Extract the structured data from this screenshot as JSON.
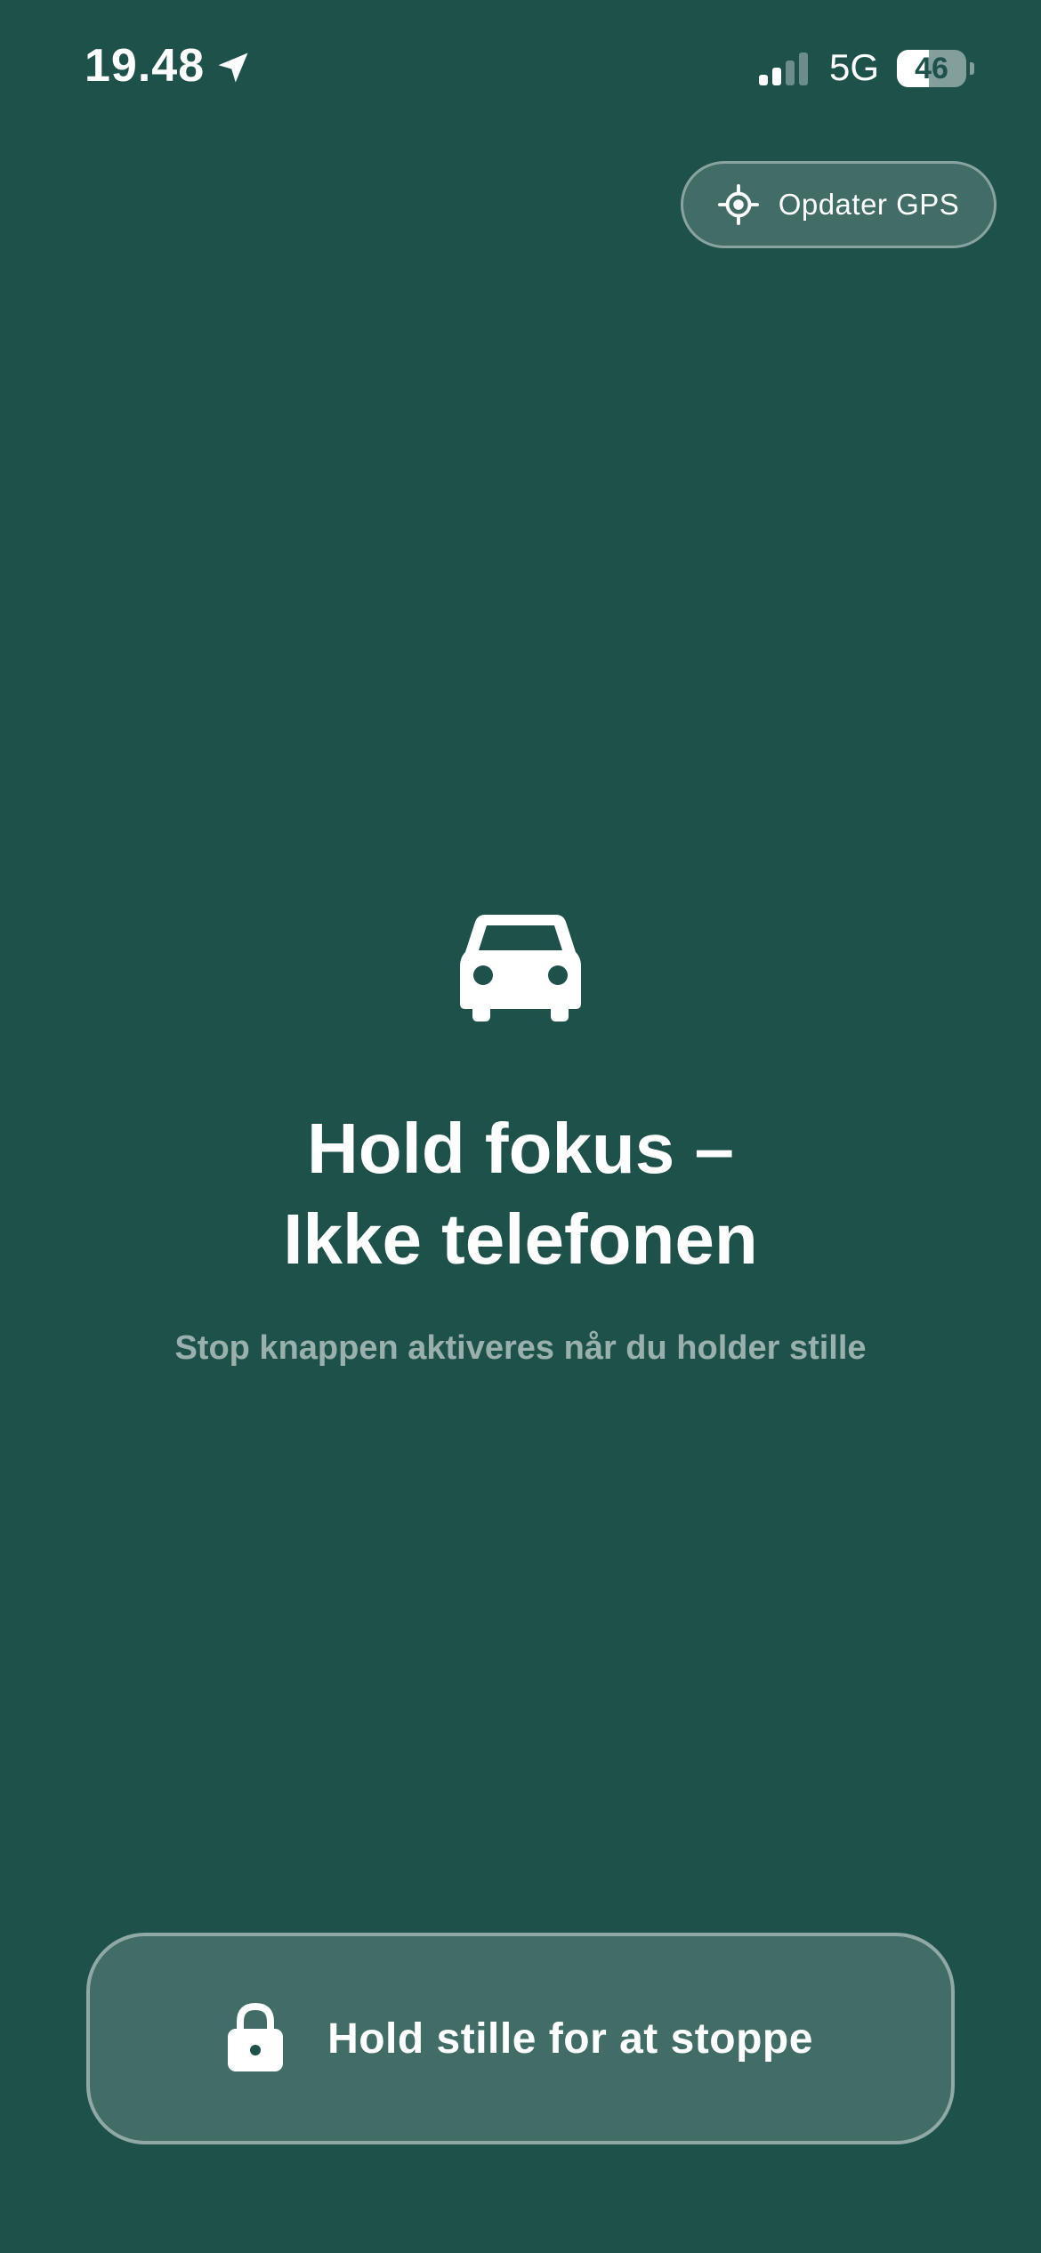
{
  "status_bar": {
    "time": "19.48",
    "network": "5G",
    "battery_percent": "46",
    "battery_level": 0.46,
    "signal_bars_active": 2,
    "signal_bars_total": 4,
    "location_icon": "location-arrow-icon"
  },
  "gps_button": {
    "label": "Opdater GPS",
    "icon": "crosshair-icon"
  },
  "main": {
    "icon": "car-icon",
    "title_line1": "Hold fokus –",
    "title_line2": "Ikke telefonen",
    "subtitle": "Stop knappen aktiveres når du holder stille"
  },
  "stop_button": {
    "label": "Hold stille for at stoppe",
    "icon": "lock-icon"
  },
  "colors": {
    "background": "#1e514a",
    "foreground": "#ffffff",
    "muted_text": "rgba(255,255,255,0.55)"
  }
}
